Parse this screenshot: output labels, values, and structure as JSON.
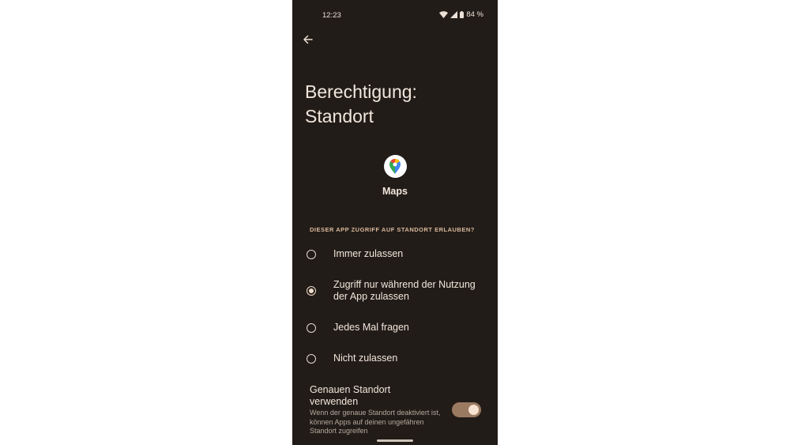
{
  "status_bar": {
    "time": "12:23",
    "battery": "84 %"
  },
  "header": {
    "title_line1": "Berechtigung:",
    "title_line2": "Standort"
  },
  "app": {
    "name": "Maps"
  },
  "permission": {
    "section_label": "DIESER APP ZUGRIFF AUF STANDORT ERLAUBEN?",
    "options": [
      {
        "label": "Immer zulassen",
        "selected": false
      },
      {
        "label": "Zugriff nur während der Nutzung der App zulassen",
        "selected": true
      },
      {
        "label": "Jedes Mal fragen",
        "selected": false
      },
      {
        "label": "Nicht zulassen",
        "selected": false
      }
    ]
  },
  "precise_location": {
    "title": "Genauen Standort verwenden",
    "description": "Wenn der genaue Standort deaktiviert ist, können Apps auf deinen ungefähren Standort zugreifen",
    "enabled": true
  },
  "colors": {
    "background": "#221c18",
    "accent": "#9b7a62"
  },
  "icons": {
    "back": "arrow-left-icon",
    "wifi": "wifi-icon",
    "signal": "signal-icon",
    "battery": "battery-icon",
    "app": "google-maps-pin-icon"
  }
}
